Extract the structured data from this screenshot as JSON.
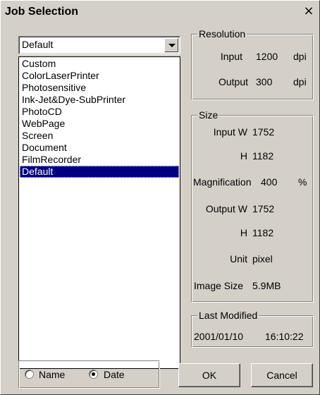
{
  "window": {
    "title": "Job Selection",
    "close_glyph": "×"
  },
  "job_combo": {
    "value": "Default"
  },
  "job_list": {
    "items": [
      "Custom",
      "ColorLaserPrinter",
      "Photosensitive",
      "Ink-Jet&Dye-SubPrinter",
      "PhotoCD",
      "WebPage",
      "Screen",
      "Document",
      "FilmRecorder",
      "Default"
    ],
    "selected_index": 9
  },
  "resolution": {
    "label": "Resolution",
    "input_label": "Input",
    "input_value": "1200",
    "input_unit": "dpi",
    "output_label": "Output",
    "output_value": "300",
    "output_unit": "dpi"
  },
  "size": {
    "label": "Size",
    "input_w_label": "Input W",
    "input_w_value": "1752",
    "input_h_label": "H",
    "input_h_value": "1182",
    "magnification_label": "Magnification",
    "magnification_value": "400",
    "magnification_unit": "%",
    "output_w_label": "Output W",
    "output_w_value": "1752",
    "output_h_label": "H",
    "output_h_value": "1182",
    "unit_label": "Unit",
    "unit_value": "pixel",
    "image_size_label": "Image Size",
    "image_size_value": "5.9MB"
  },
  "last_modified": {
    "label": "Last Modified",
    "date": "2001/01/10",
    "time": "16:10:22"
  },
  "sort": {
    "name_label": "Name",
    "date_label": "Date",
    "selected": "Date"
  },
  "buttons": {
    "ok": "OK",
    "cancel": "Cancel"
  }
}
